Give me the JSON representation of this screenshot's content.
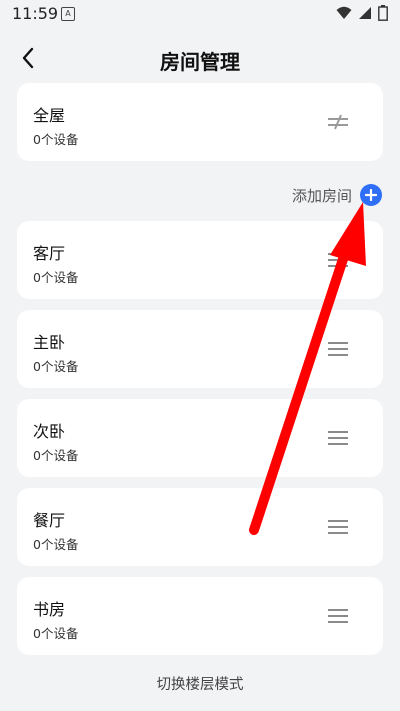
{
  "status_bar": {
    "time": "11:59",
    "notification_letter": "A"
  },
  "header": {
    "title": "房间管理"
  },
  "whole_house": {
    "name": "全屋",
    "device_count": "0个设备"
  },
  "add_room": {
    "label": "添加房间"
  },
  "rooms": [
    {
      "name": "客厅",
      "device_count": "0个设备"
    },
    {
      "name": "主卧",
      "device_count": "0个设备"
    },
    {
      "name": "次卧",
      "device_count": "0个设备"
    },
    {
      "name": "餐厅",
      "device_count": "0个设备"
    },
    {
      "name": "书房",
      "device_count": "0个设备"
    }
  ],
  "footer": {
    "switch_mode_label": "切换楼层模式"
  },
  "colors": {
    "accent": "#2f6ef7",
    "annotation_arrow": "#ff0000",
    "background": "#f2f3f5",
    "card": "#ffffff"
  }
}
